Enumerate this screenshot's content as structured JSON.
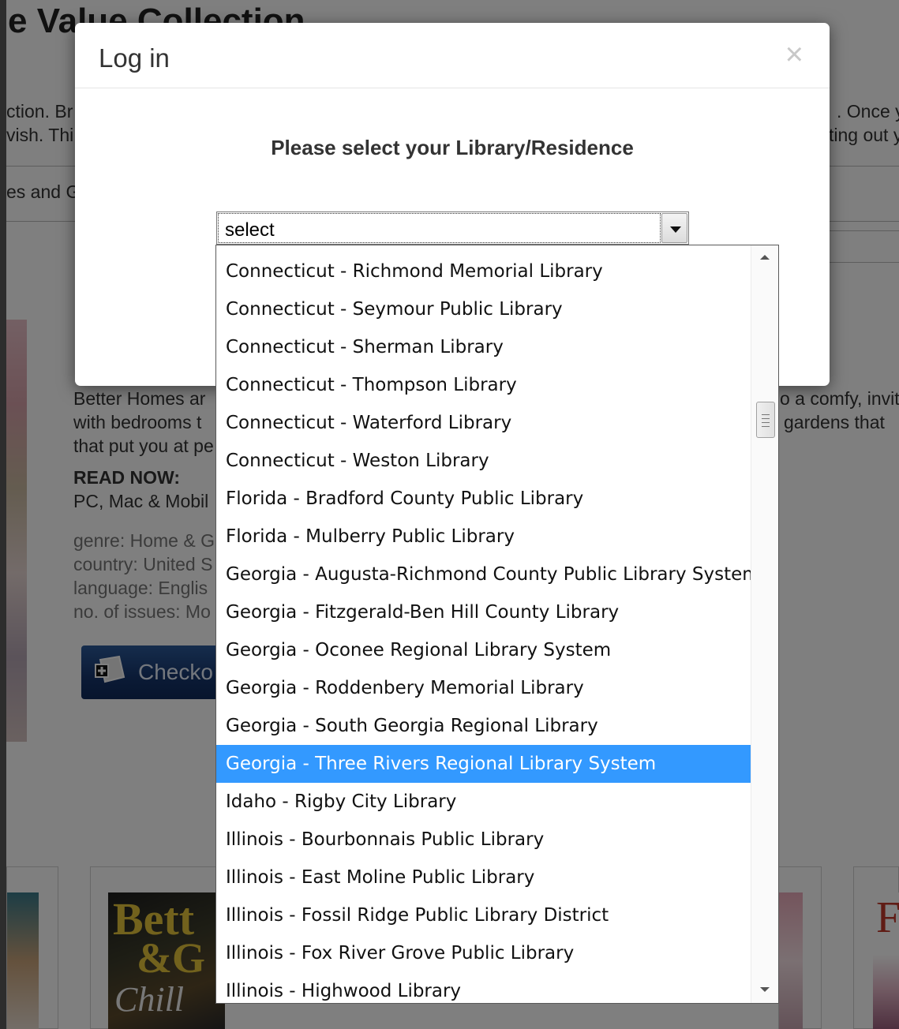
{
  "background": {
    "title": "e Value Collection",
    "snippets": {
      "left1": "ction. Br",
      "left2": "vish. Thi",
      "left3": "es and G",
      "right1": ". Once y",
      "right2": "ting out y",
      "right3": "o a comfy, invit",
      "right4": "gardens that"
    },
    "description": {
      "line1": "Better Homes ar",
      "line2": "with bedrooms t",
      "line3": "that put you at pe",
      "read_now": "READ NOW:",
      "platforms": "PC, Mac & Mobil",
      "genre": "genre: Home & G",
      "country": "country: United S",
      "language": "language: Englis",
      "issues": "no. of issues: Mo"
    },
    "checkout_label": "Checko"
  },
  "modal": {
    "title": "Log in",
    "close_symbol": "×",
    "prompt": "Please select your Library/Residence"
  },
  "select": {
    "value": "select",
    "options": [
      "Connecticut - Richmond Memorial Library",
      "Connecticut - Seymour Public Library",
      "Connecticut - Sherman Library",
      "Connecticut - Thompson Library",
      "Connecticut - Waterford Library",
      "Connecticut - Weston Library",
      "Florida - Bradford County Public Library",
      "Florida - Mulberry Public Library",
      "Georgia - Augusta-Richmond County Public Library System",
      "Georgia - Fitzgerald-Ben Hill County Library",
      "Georgia - Oconee Regional Library System",
      "Georgia - Roddenbery Memorial Library",
      "Georgia - South Georgia Regional Library",
      "Georgia - Three Rivers Regional Library System",
      "Idaho - Rigby City Library",
      "Illinois - Bourbonnais Public Library",
      "Illinois - East Moline Public Library",
      "Illinois - Fossil Ridge Public Library District",
      "Illinois - Fox River Grove Public Library",
      "Illinois - Highwood Library"
    ],
    "highlighted": "Georgia - Three Rivers Regional Library System"
  },
  "colors": {
    "highlight": "#3399ff",
    "overlay": "rgba(0,0,0,0.5)"
  },
  "icons": {
    "close": "close-icon",
    "dropdown": "chevron-down-icon",
    "checkout": "checkout-book-icon"
  }
}
